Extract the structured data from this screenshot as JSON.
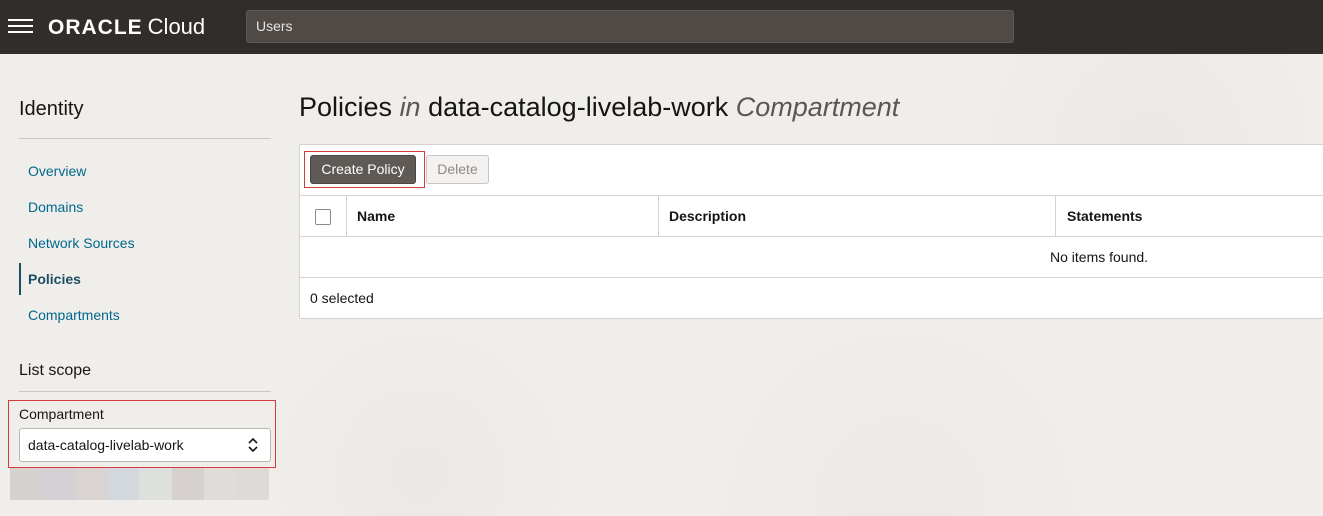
{
  "header": {
    "brand": "ORACLE",
    "product": "Cloud",
    "search_value": "Users"
  },
  "sidebar": {
    "title": "Identity",
    "items": [
      {
        "label": "Overview",
        "active": false
      },
      {
        "label": "Domains",
        "active": false
      },
      {
        "label": "Network Sources",
        "active": false
      },
      {
        "label": "Policies",
        "active": true
      },
      {
        "label": "Compartments",
        "active": false
      }
    ],
    "scope_title": "List scope",
    "compartment_label": "Compartment",
    "compartment_value": "data-catalog-livelab-work"
  },
  "main": {
    "title_prefix": "Policies",
    "title_in": "in",
    "title_compartment": "data-catalog-livelab-work",
    "title_suffix": "Compartment",
    "toolbar": {
      "create_label": "Create Policy",
      "delete_label": "Delete"
    },
    "table": {
      "columns": [
        "Name",
        "Description",
        "Statements"
      ],
      "empty_message": "No items found.",
      "selected_count": "0 selected"
    }
  },
  "colors": {
    "header_bg": "#312d2a",
    "link": "#00688c",
    "highlight": "#d63b3b",
    "primary_button": "#5f5a55"
  }
}
